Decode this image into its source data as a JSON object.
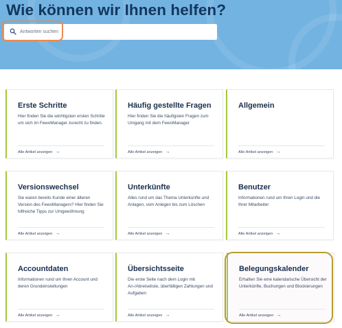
{
  "header": {
    "title": "Wie können wir Ihnen helfen?",
    "search_placeholder": "Antworten suchen"
  },
  "colors": {
    "hero_background": "#72b3e1",
    "title": "#13365e",
    "card_accent": "#a7c73a",
    "search_highlight": "#e98b4f",
    "card_highlight": "#b89a2c"
  },
  "categories": [
    {
      "title": "Erste Schritte",
      "description": "Hier finden Sie die wichtigsten ersten Schritte um sich im FewoManager zurecht zu finden.",
      "link": "Alle Artikel anzeigen"
    },
    {
      "title": "Häufig gestellte Fragen",
      "description": "Hier finden Sie die häufigsten Fragen zum Umgang mit dem FewoManager",
      "link": "Alle Artikel anzeigen"
    },
    {
      "title": "Allgemein",
      "description": "",
      "link": "Alle Artikel anzeigen"
    },
    {
      "title": "Versionswechsel",
      "description": "Sie waren bereits Kunde einer älteren Version des FewoManagers? Hier finden Sie hilfreiche Tipps zur Umgewöhnung",
      "link": "Alle Artikel anzeigen"
    },
    {
      "title": "Unterkünfte",
      "description": "Alles rund um das Thema Unterkünfte und Anlagen, vom Anlegen bis zum Löschen",
      "link": "Alle Artikel anzeigen"
    },
    {
      "title": "Benutzer",
      "description": "Informationen rund um Ihren Login und die Ihrer Mitarbeiter",
      "link": "Alle Artikel anzeigen"
    },
    {
      "title": "Accountdaten",
      "description": "Informationen rund um Ihren Account und deren Grundeinstellungen",
      "link": "Alle Artikel anzeigen"
    },
    {
      "title": "Übersichtsseite",
      "description": "Die erste Seite nach dem Login mit An-/Abreiseliste, überfälligen Zahlungen und Aufgaben",
      "link": "Alle Artikel anzeigen"
    },
    {
      "title": "Belegungskalender",
      "description": "Erhalten Sie eine kalendarische Übersicht der Unterkünfte, Buchungen und Blockierungen",
      "link": "Alle Artikel anzeigen"
    }
  ]
}
